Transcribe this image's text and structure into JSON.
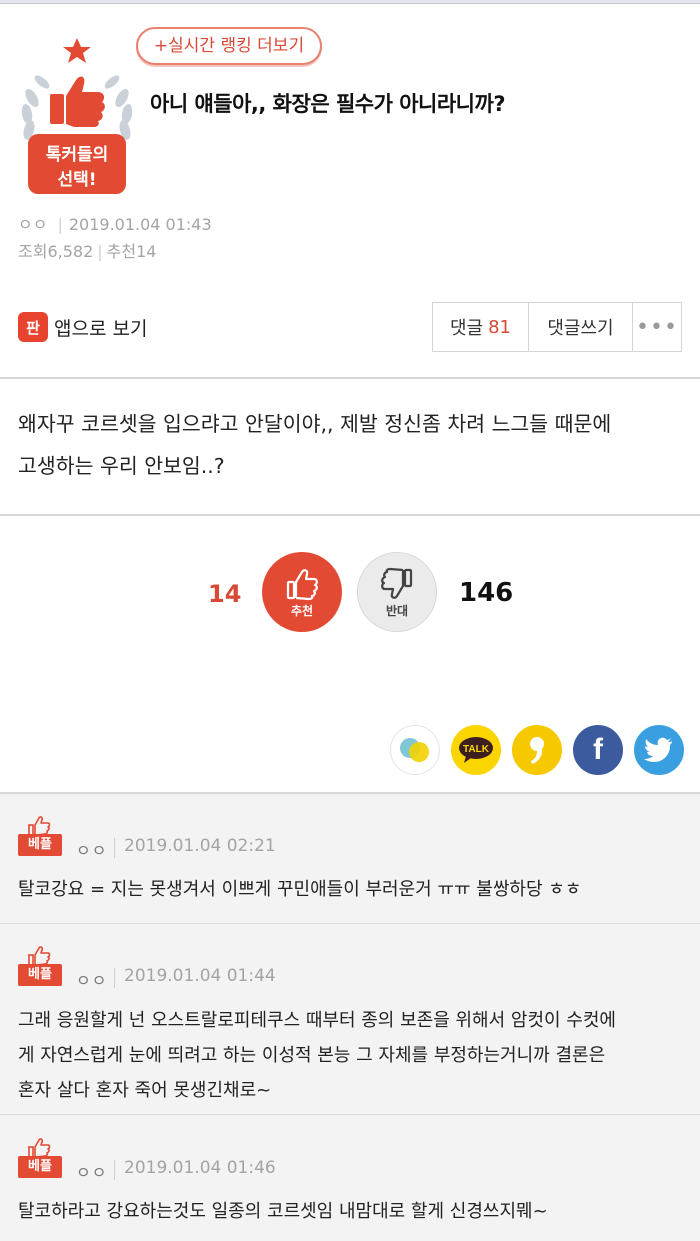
{
  "header": {
    "ranking_link": "+실시간 랭킹 더보기",
    "badge_text_line1": "톡커들의",
    "badge_text_line2": "선택!",
    "title": "아니 얘들아,, 화장은 필수가 아니라니까?"
  },
  "meta": {
    "author": "ㅇㅇ",
    "datetime": "2019.01.04 01:43",
    "views_label": "조회",
    "views": "6,582",
    "recommend_label": "추천",
    "recommend": "14"
  },
  "toolbar": {
    "app_icon": "판",
    "app_view_label": "앱으로 보기",
    "comments_label": "댓글",
    "comments_count": "81",
    "write_comment_label": "댓글쓰기",
    "more_label": "•••"
  },
  "post": {
    "body_line1": "왜자꾸 코르셋을 입으랴고 안달이야,, 제발 정신좀 차려 느그들 때문에",
    "body_line2": "고생하는 우리 안보임..?"
  },
  "vote": {
    "up_count": "14",
    "up_label": "추천",
    "down_label": "반대",
    "down_count": "146"
  },
  "share": {
    "kakao_label": "TALK",
    "facebook_label": "f",
    "icons": [
      "kakaostory-chat-icon",
      "kakaotalk-icon",
      "kakaostory-icon",
      "facebook-icon",
      "twitter-icon"
    ]
  },
  "comments": [
    {
      "badge": "베플",
      "author": "ㅇㅇ",
      "datetime": "2019.01.04 02:21",
      "lines": [
        "탈코강요 = 지는 못생겨서 이쁘게 꾸민애들이 부러운거 ㅠㅠ 불쌍하당 ㅎㅎ"
      ]
    },
    {
      "badge": "베플",
      "author": "ㅇㅇ",
      "datetime": "2019.01.04 01:44",
      "lines": [
        "그래 응원할게 넌 오스트랄로피테쿠스 때부터 종의 보존을 위해서 암컷이 수컷에",
        "게 자연스럽게 눈에 띄려고 하는 이성적 본능 그 자체를 부정하는거니까 결론은",
        "혼자 살다 혼자 죽어 못생긴채로~"
      ]
    },
    {
      "badge": "베플",
      "author": "ㅇㅇ",
      "datetime": "2019.01.04 01:46",
      "lines": [
        "탈코하라고 강요하는것도 일종의 코르셋임 내맘대로 할게 신경쓰지뭬~"
      ]
    }
  ],
  "colors": {
    "accent": "#e34a33",
    "muted": "#a4a4a4",
    "comment_bg": "#f3f3f3"
  }
}
